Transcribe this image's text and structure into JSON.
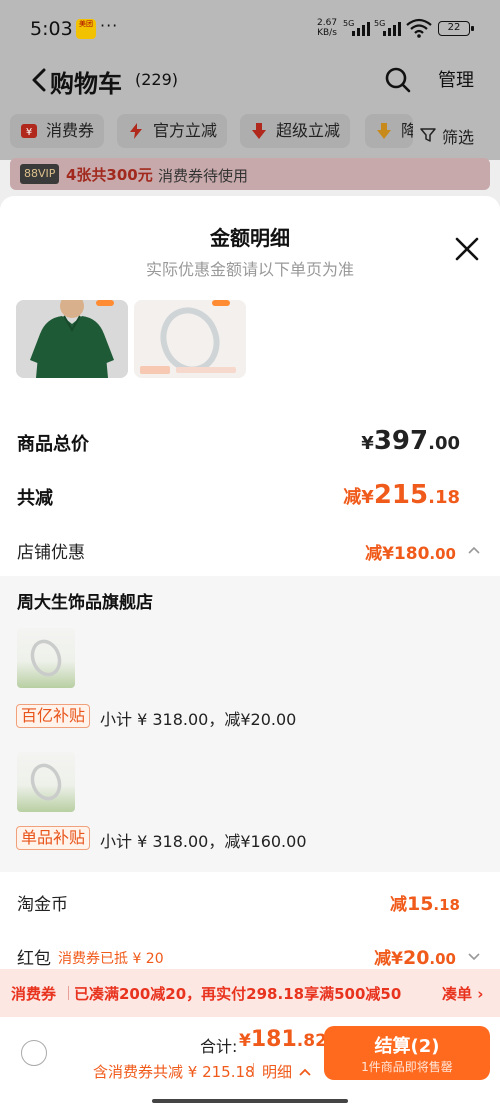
{
  "status_bar": {
    "time": "5:03",
    "app_badge": "美团",
    "dots": "···",
    "speed_value": "2.67",
    "speed_unit": "KB/s",
    "sig1": "5G",
    "sig2": "5G",
    "battery": "22"
  },
  "header": {
    "title": "购物车",
    "count": "(229)",
    "manage": "管理"
  },
  "filters": {
    "items": [
      {
        "label": "消费券",
        "icon": "coupon-icon"
      },
      {
        "label": "官方立减",
        "icon": "lightning-icon"
      },
      {
        "label": "超级立减",
        "icon": "down-arrow-icon"
      },
      {
        "label": "降",
        "icon": "price-drop-icon"
      }
    ],
    "filter_label": "筛选"
  },
  "coupon_banner": {
    "vip": "88VIP",
    "highlight": "4张共300元",
    "text": "消费券待使用"
  },
  "sheet": {
    "title": "金额明细",
    "subtitle": "实际优惠金额请以下单页为准",
    "total": {
      "label": "商品总价",
      "yen": "¥",
      "int": "397",
      "dec": ".00"
    },
    "reduction": {
      "label": "共减",
      "prefix": "减¥",
      "int": "215",
      "dec": ".18"
    },
    "shop_discount": {
      "label": "店铺优惠",
      "prefix": "减¥",
      "int": "180",
      "dec": ".00"
    },
    "shop": {
      "name": "周大生饰品旗舰店",
      "items": [
        {
          "tag": "百亿补贴",
          "subtotal": "小计 ¥ 318.00，减¥20.00"
        },
        {
          "tag": "单品补贴",
          "subtotal": "小计 ¥ 318.00，减¥160.00"
        }
      ]
    },
    "taojinbi": {
      "label": "淘金币",
      "prefix": "减",
      "int": "15",
      "dec": ".18"
    },
    "red_packet": {
      "label": "红包",
      "note": "消费券已抵 ¥ 20",
      "prefix": "减¥",
      "int": "20",
      "dec": ".00"
    }
  },
  "promo": {
    "label": "消费券",
    "text": "已凑满200减20，再实付298.18享满500减50",
    "link": "凑单 ›"
  },
  "checkout": {
    "total_label": "合计:",
    "yen": "¥",
    "int": "181",
    "dec": ".82",
    "discount_text": "含消费券共减 ¥ 215.18",
    "detail_link": "明细",
    "button_label": "结算(2)",
    "button_sub": "1件商品即将售罄"
  },
  "colors": {
    "accent": "#ff6a1f",
    "discount": "#f05a1a",
    "promo_bg": "#fde7e3"
  }
}
